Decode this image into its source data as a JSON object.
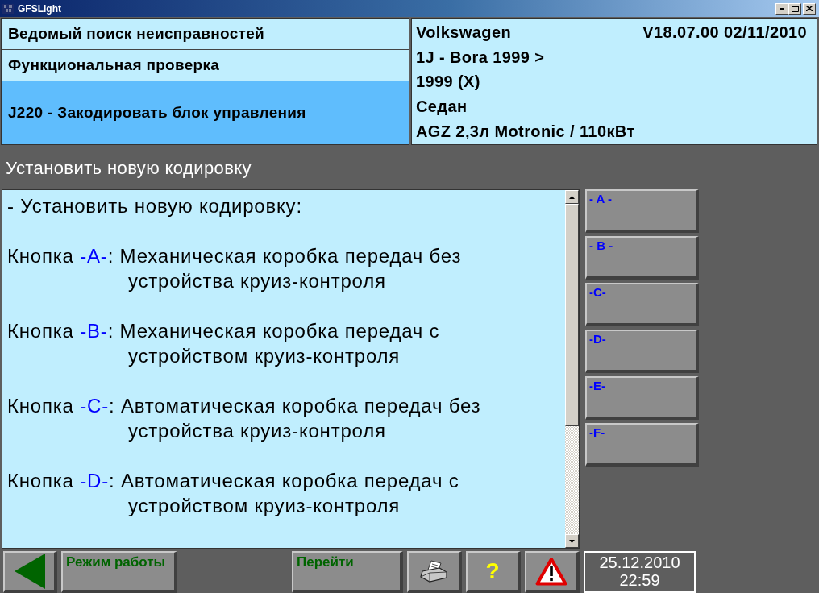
{
  "window": {
    "title": "GFSLight"
  },
  "navigation": [
    {
      "label": "Ведомый поиск неисправностей",
      "selected": false
    },
    {
      "label": "Функциональная проверка",
      "selected": false
    },
    {
      "label": "J220 - Закодировать блок управления",
      "selected": true
    }
  ],
  "vehicle": {
    "make": "Volkswagen",
    "version": "V18.07.00 02/11/2010",
    "lines": [
      "1J - Bora 1999 >",
      "1999 (X)",
      "Седан",
      "AGZ 2,3л Motronic / 110кВт"
    ]
  },
  "screen_title": "Установить новую кодировку",
  "instructions": {
    "intro": "- Установить новую кодировку:",
    "options": [
      {
        "label": "Кнопка",
        "key": "-A-",
        "lines": [
          ": Механическая коробка передач без",
          "устройства круиз-контроля"
        ]
      },
      {
        "label": "Кнопка",
        "key": "-B-",
        "lines": [
          ": Механическая коробка передач с",
          "устройством круиз-контроля"
        ]
      },
      {
        "label": "Кнопка",
        "key": "-C-",
        "lines": [
          ": Автоматическая коробка передач без",
          "устройства круиз-контроля"
        ]
      },
      {
        "label": "Кнопка",
        "key": "-D-",
        "lines": [
          ": Автоматическая коробка передач с",
          "устройством круиз-контроля"
        ]
      }
    ]
  },
  "side_buttons": [
    {
      "label": "- A -"
    },
    {
      "label": "- B -"
    },
    {
      "label": "-C-"
    },
    {
      "label": "-D-"
    },
    {
      "label": "-E-"
    },
    {
      "label": "-F-"
    }
  ],
  "toolbar": [
    {
      "kind": "back"
    },
    {
      "kind": "text",
      "label": "Режим работы"
    },
    {
      "kind": "text",
      "label": "Перейти"
    },
    {
      "kind": "print"
    },
    {
      "kind": "help",
      "label": "?"
    },
    {
      "kind": "warning"
    }
  ],
  "clock": {
    "date": "25.12.2010",
    "time": "22:59"
  }
}
